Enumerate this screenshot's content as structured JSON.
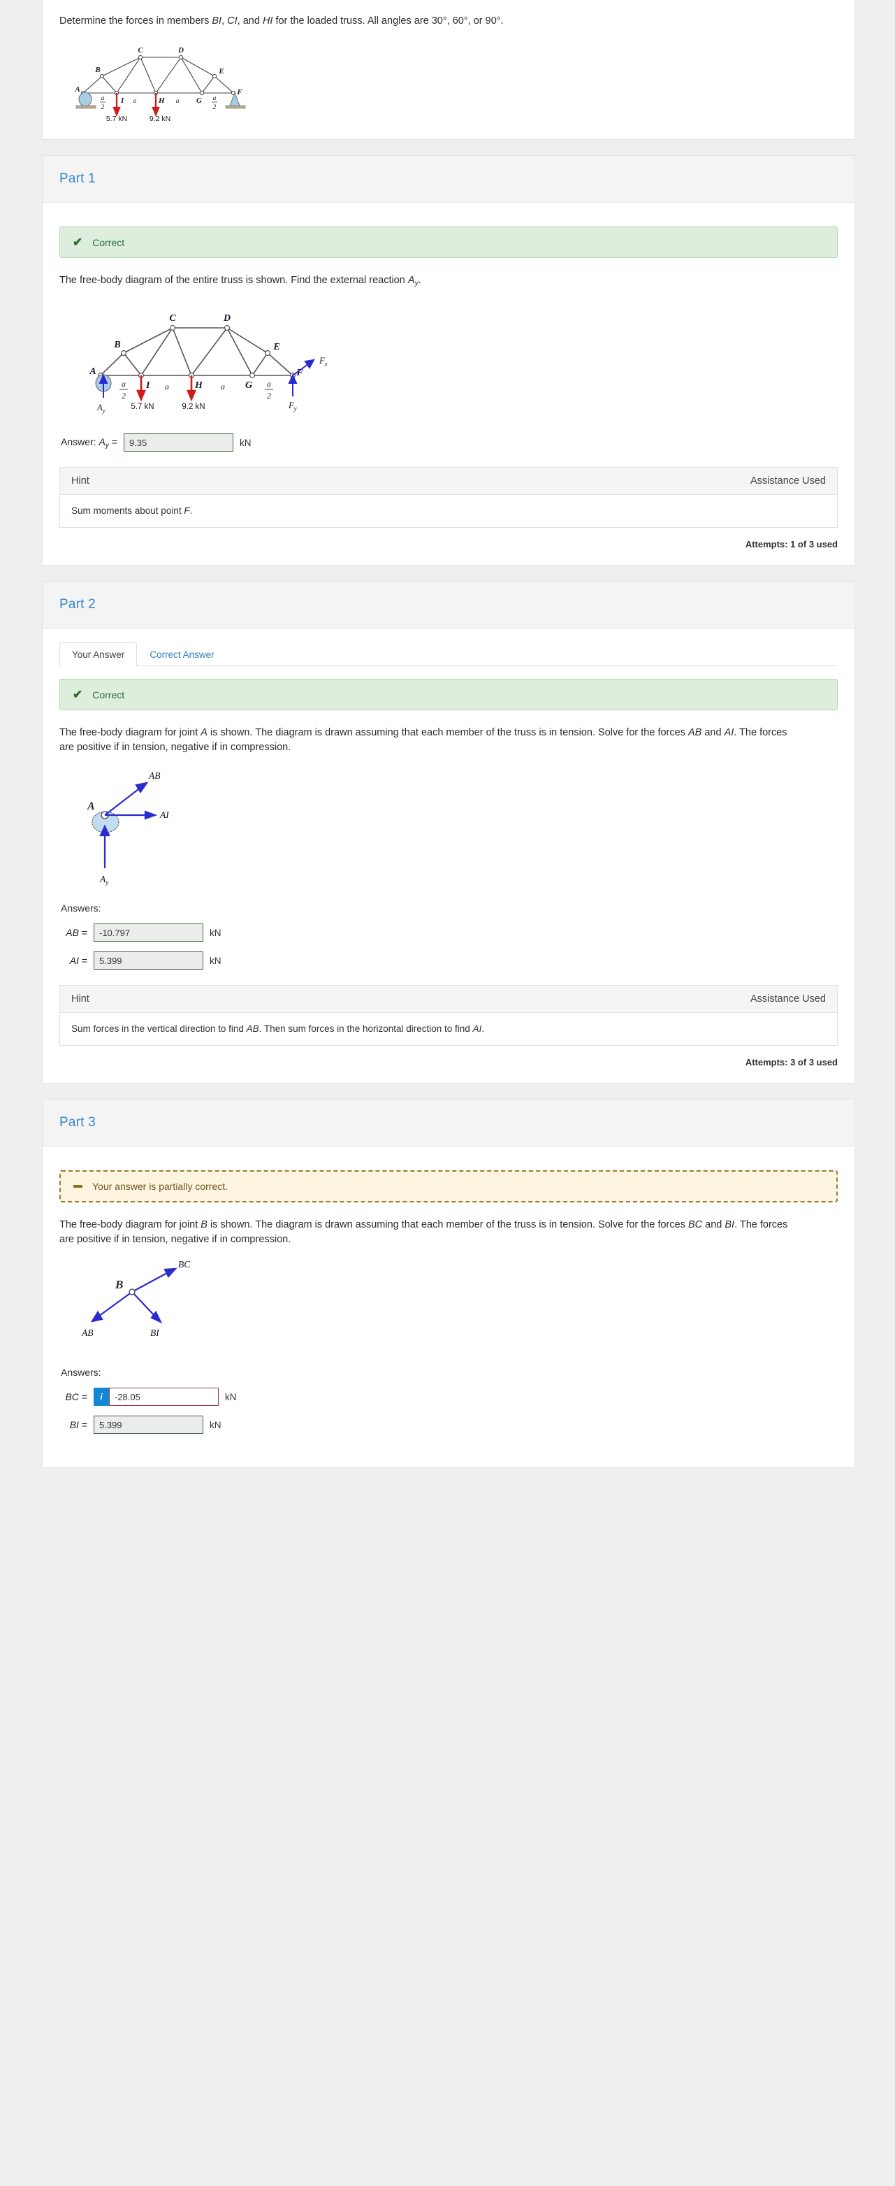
{
  "problem": {
    "statement_plain": "Determine the forces in members BI, CI, and HI for the loaded truss. All angles are 30°, 60°, or 90°.",
    "statement_a": "Determine the forces in members ",
    "member_1": "BI",
    "sep_1": ", ",
    "member_2": "CI",
    "sep_2": ", and ",
    "member_3": "HI",
    "statement_b": " for the loaded truss. All angles are 30°, 60°, or 90°."
  },
  "figure_main": {
    "nodes": [
      "A",
      "B",
      "C",
      "D",
      "E",
      "F",
      "G",
      "H",
      "I"
    ],
    "load_left": "5.7 kN",
    "load_right": "9.2 kN",
    "dim_a_half_left": "a/2",
    "dim_a_1": "a",
    "dim_a_2": "a",
    "dim_a_half_right": "a/2",
    "label_a": "a",
    "label_a_over_2_num": "a",
    "label_a_over_2_den": "2"
  },
  "parts": [
    {
      "title": "Part 1",
      "has_tabs": false,
      "status": {
        "type": "correct",
        "icon": "check-icon",
        "text": "Correct"
      },
      "description_pre": "The free-body diagram of the entire truss is shown. Find the external reaction ",
      "description_var": "A",
      "description_sub": "y",
      "description_post": ".",
      "figure": {
        "reactions": [
          "A_y",
          "F_x",
          "F_y"
        ],
        "reaction_ay": "A",
        "reaction_ay_sub": "y",
        "reaction_fx": "F",
        "reaction_fx_sub": "x",
        "reaction_fy": "F",
        "reaction_fy_sub": "y",
        "load_left": "5.7 kN",
        "load_right": "9.2 kN"
      },
      "answer_inline": {
        "label_pre": "Answer: ",
        "label_var": "A",
        "label_sub": "y",
        "label_eq": " =",
        "value": "9.35",
        "unit": "kN",
        "state": "correct"
      },
      "hint": {
        "title": "Hint",
        "assistance": "Assistance Used",
        "body_pre": "Sum moments about point ",
        "body_var": "F",
        "body_post": "."
      },
      "attempts": "Attempts: 1 of 3 used"
    },
    {
      "title": "Part 2",
      "has_tabs": true,
      "tabs": [
        {
          "label": "Your Answer",
          "active": true
        },
        {
          "label": "Correct Answer",
          "active": false
        }
      ],
      "status": {
        "type": "correct",
        "icon": "check-icon",
        "text": "Correct"
      },
      "description_line1_pre": "The free-body diagram for joint ",
      "description_joint": "A",
      "description_line1_post": " is shown. The diagram is drawn assuming that each member of the truss is in tension. Solve for the forces ",
      "description_force1": "AB",
      "description_and": " and ",
      "description_force2": "AI",
      "description_line2_post": ". The forces are positive if in tension, negative if in compression.",
      "figure": {
        "joint": "A",
        "force_up_right": "AB",
        "force_right": "AI",
        "reaction": "A",
        "reaction_sub": "y"
      },
      "answers_label": "Answers:",
      "answers": [
        {
          "label": "AB",
          "eq": " =",
          "value": "-10.797",
          "unit": "kN",
          "state": "correct",
          "info": false
        },
        {
          "label": "AI",
          "eq": " =",
          "value": "5.399",
          "unit": "kN",
          "state": "correct",
          "info": false
        }
      ],
      "hint": {
        "title": "Hint",
        "assistance": "Assistance Used",
        "body_pre": "Sum forces in the vertical direction to find ",
        "body_var1": "AB",
        "body_mid": ". Then sum forces in the horizontal direction to find ",
        "body_var2": "AI",
        "body_post": "."
      },
      "attempts": "Attempts: 3 of 3 used"
    },
    {
      "title": "Part 3",
      "has_tabs": false,
      "status": {
        "type": "partial",
        "icon": "dash-icon",
        "text": "Your answer is partially correct."
      },
      "description_line1_pre": "The free-body diagram for joint ",
      "description_joint": "B",
      "description_line1_post": " is shown. The diagram is drawn assuming that each member of the truss is in tension. Solve for the forces ",
      "description_force1": "BC",
      "description_and": " and ",
      "description_force2": "BI",
      "description_line2_post": ". The forces are positive if in tension, negative if in compression.",
      "figure": {
        "joint": "B",
        "force_up_right": "BC",
        "force_down_left": "AB",
        "force_down_right": "BI"
      },
      "answers_label": "Answers:",
      "answers": [
        {
          "label": "BC",
          "eq": " =",
          "value": "-28.05",
          "unit": "kN",
          "state": "wrong",
          "info": true,
          "info_icon": "info-icon",
          "info_glyph": "i"
        },
        {
          "label": "BI",
          "eq": " =",
          "value": "5.399",
          "unit": "kN",
          "state": "correct",
          "info": false
        }
      ]
    }
  ],
  "colors": {
    "accent_blue": "#3a87c8",
    "correct_bg": "#ddeedd",
    "correct_border": "#b6d4b6",
    "correct_text": "#33693a",
    "partial_bg": "#fdf5e0",
    "partial_border": "#9a7a33",
    "input_ok_border": "#3d6b3c",
    "input_wrong_border": "#9c3a3a",
    "info_badge": "#1288d4",
    "force_arrow": "#2a2ad0",
    "load_arrow": "#d31a1a",
    "support": "#a9cde4"
  }
}
